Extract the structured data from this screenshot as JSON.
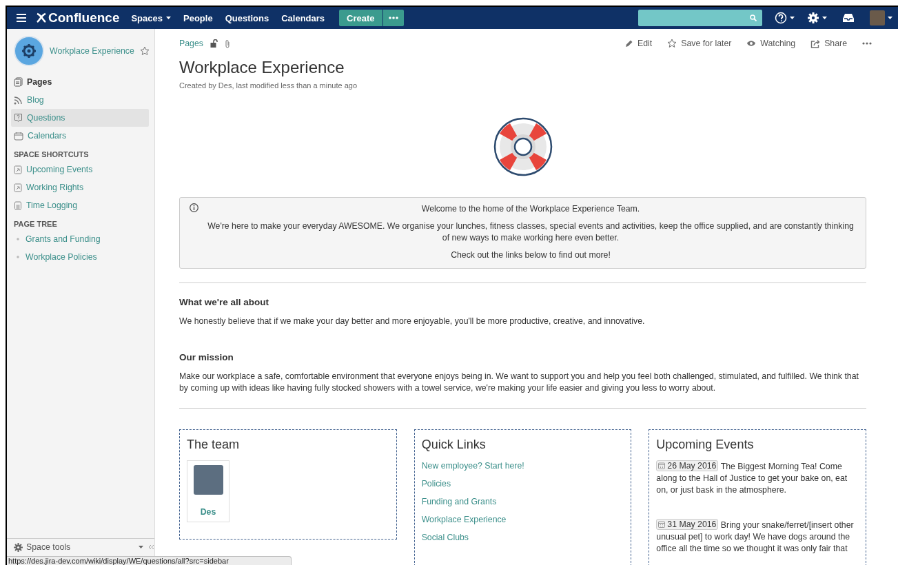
{
  "nav": {
    "logo": "Confluence",
    "items": [
      {
        "label": "Spaces",
        "kind": "dropdown"
      },
      {
        "label": "People",
        "kind": "link"
      },
      {
        "label": "Questions",
        "kind": "link"
      },
      {
        "label": "Calendars",
        "kind": "link"
      }
    ],
    "create": "Create"
  },
  "sidebar": {
    "space_name": "Workplace Experience",
    "items": [
      {
        "label": "Pages",
        "kind": "pages",
        "selected": false
      },
      {
        "label": "Blog",
        "kind": "blog",
        "selected": false
      },
      {
        "label": "Questions",
        "kind": "questions",
        "selected": true
      },
      {
        "label": "Calendars",
        "kind": "calendar",
        "selected": false
      }
    ],
    "sections": [
      {
        "heading": "SPACE SHORTCUTS",
        "kind": "shortcuts",
        "items": [
          {
            "label": "Upcoming Events",
            "kind": "shortcut"
          },
          {
            "label": "Working Rights",
            "kind": "shortcut"
          },
          {
            "label": "Time Logging",
            "kind": "page"
          }
        ]
      },
      {
        "heading": "PAGE TREE",
        "kind": "tree",
        "items": [
          {
            "label": "Grants and Funding",
            "kind": "bullet"
          },
          {
            "label": "Workplace Policies",
            "kind": "bullet"
          }
        ]
      }
    ],
    "space_tools": "Space tools"
  },
  "page": {
    "breadcrumb": "Pages",
    "actions": [
      {
        "label": "Edit",
        "kind": "pencil"
      },
      {
        "label": "Save for later",
        "kind": "star"
      },
      {
        "label": "Watching",
        "kind": "eye"
      },
      {
        "label": "Share",
        "kind": "share"
      }
    ],
    "title": "Workplace Experience",
    "byline": "Created by Des, last modified less than a minute ago",
    "info_panel": [
      "Welcome to the home of the Workplace Experience Team.",
      "We're here to make your everyday AWESOME. We organise your lunches, fitness classes, special events and activities, keep the office supplied, and are constantly thinking of new ways to make working here even better.",
      "Check out the links below to find out more!"
    ],
    "sections": [
      {
        "heading": "What we're all about",
        "text": "We honestly believe that if we make your day better and more enjoyable, you'll be more productive, creative, and innovative."
      },
      {
        "heading": "Our mission",
        "text": "Make our workplace a safe, comfortable environment that everyone enjoys being in. We want to support you and help you feel both challenged, stimulated, and fulfilled. We think that by coming up with ideas like having fully stocked showers with a towel service, we're making your life easier and giving you less to worry about."
      }
    ],
    "cards": [
      {
        "title": "The team",
        "kind": "team",
        "members": [
          {
            "name": "Des"
          }
        ]
      },
      {
        "title": "Quick Links",
        "kind": "links",
        "links": [
          "New employee? Start here!",
          "Policies",
          "Funding and Grants",
          "Workplace Experience",
          "Social Clubs"
        ]
      },
      {
        "title": "Upcoming Events",
        "kind": "events",
        "events": [
          {
            "date": "26 May 2016",
            "text": "The Biggest Morning Tea! Come along to the Hall of Justice to get your bake on, eat on, or just bask in the atmosphere."
          },
          {
            "date": "31 May 2016",
            "text": "Bring your snake/ferret/[insert other unusual pet] to work day! We have dogs around the office all the time so we thought it was only fair that"
          }
        ]
      }
    ]
  },
  "status_url": "https://des.jira-dev.com/wiki/display/WE/questions/all?src=sidebar"
}
